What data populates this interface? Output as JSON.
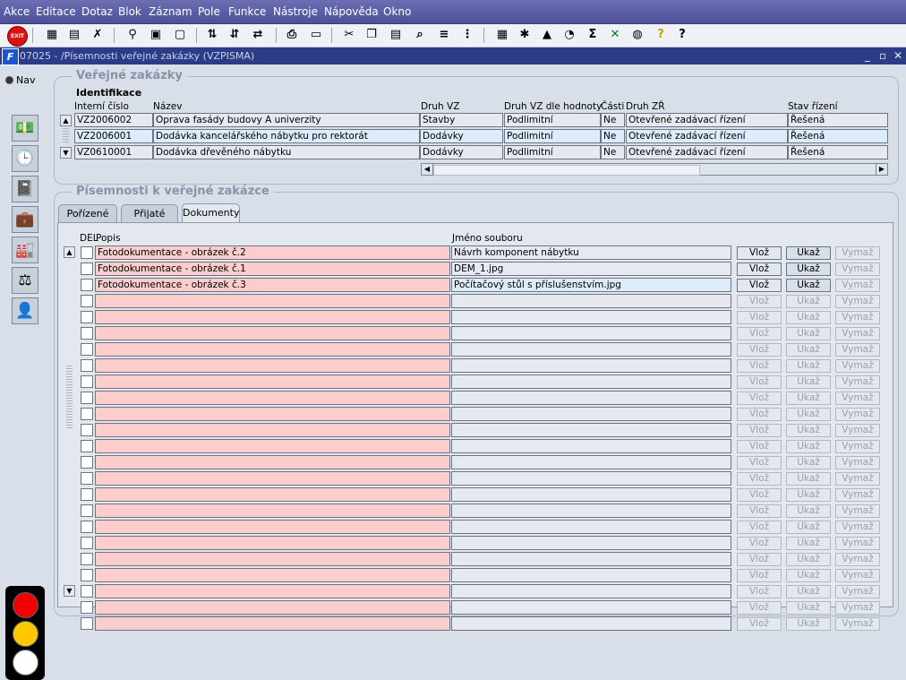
{
  "menu": [
    "Akce",
    "Editace",
    "Dotaz",
    "Blok",
    "Záznam",
    "Pole",
    "Funkce",
    "Nástroje",
    "Nápověda",
    "Okno"
  ],
  "toolbar_icons": [
    "exit-icon",
    "new-record-icon",
    "insert-record-icon",
    "delete-record-icon",
    "find-icon",
    "enter-query-icon",
    "cancel-query-icon",
    "sort-asc-icon",
    "sort-desc-icon",
    "sort-multi-icon",
    "print-icon",
    "print-preview-icon",
    "cut-icon",
    "copy-icon",
    "paste-icon",
    "search-replace-icon",
    "indent-icon",
    "columns-icon",
    "calculator-icon",
    "tools-icon",
    "warning-icon",
    "chart-icon",
    "sum-icon",
    "excel-icon",
    "globe-icon",
    "help-query-icon",
    "help-icon"
  ],
  "exit_label": "EXIT",
  "window": {
    "title": "07025 - /Písemnosti veřejné zakázky (VZPISMA)"
  },
  "nav_label": "Nav",
  "section1": {
    "title": "Veřejné zakázky",
    "subtitle": "Identifikace",
    "headers": {
      "interni": "Interní číslo",
      "nazev": "Název",
      "druh": "Druh VZ",
      "druh_hodnoty": "Druh VZ dle hodnoty",
      "casti": "Části",
      "druh_zr": "Druh ZŘ",
      "stav": "Stav řízení"
    },
    "rows": [
      {
        "interni": "VZ2006002",
        "nazev": "Oprava fasády budovy A univerzity",
        "druh": "Stavby",
        "druh_hodnoty": "Podlimitní",
        "casti": "Ne",
        "druh_zr": "Otevřené zadávací řízení",
        "stav": "Řešená",
        "selected": false
      },
      {
        "interni": "VZ2006001",
        "nazev": "Dodávka kancelářského nábytku pro rektorát",
        "druh": "Dodávky",
        "druh_hodnoty": "Podlimitní",
        "casti": "Ne",
        "druh_zr": "Otevřené zadávací řízení",
        "stav": "Řešená",
        "selected": true
      },
      {
        "interni": "VZ0610001",
        "nazev": "Dodávka dřevěného nábytku",
        "druh": "Dodávky",
        "druh_hodnoty": "Podlimitní",
        "casti": "Ne",
        "druh_zr": "Otevřené zadávací řízení",
        "stav": "Řešená",
        "selected": false
      }
    ]
  },
  "section2": {
    "title": "Písemnosti k veřejné zakázce",
    "tabs": [
      "Pořízené",
      "Přijaté",
      "Dokumenty"
    ],
    "active_tab": 2,
    "headers": {
      "del": "DEL",
      "popis": "Popis",
      "jmeno": "Jméno souboru"
    },
    "buttons": {
      "vloz": "Vlož",
      "ukaz": "Ukaž",
      "vymaz": "Vymaž"
    },
    "rows": [
      {
        "popis": "Fotodokumentace - obrázek č.2",
        "jmeno": "Návrh komponent nábytku",
        "selected": false,
        "vloz": true,
        "ukaz": true,
        "vymaz": false
      },
      {
        "popis": "Fotodokumentace - obrázek č.1",
        "jmeno": "DEM_1.jpg",
        "selected": false,
        "vloz": true,
        "ukaz": true,
        "vymaz": false
      },
      {
        "popis": "Fotodokumentace - obrázek č.3",
        "jmeno": "Počítačový stůl s příslušenstvím.jpg",
        "selected": true,
        "vloz": true,
        "ukaz": true,
        "vymaz": false
      },
      {
        "popis": "",
        "jmeno": "",
        "selected": false,
        "vloz": false,
        "ukaz": false,
        "vymaz": false
      },
      {
        "popis": "",
        "jmeno": "",
        "selected": false,
        "vloz": false,
        "ukaz": false,
        "vymaz": false
      },
      {
        "popis": "",
        "jmeno": "",
        "selected": false,
        "vloz": false,
        "ukaz": false,
        "vymaz": false
      },
      {
        "popis": "",
        "jmeno": "",
        "selected": false,
        "vloz": false,
        "ukaz": false,
        "vymaz": false
      },
      {
        "popis": "",
        "jmeno": "",
        "selected": false,
        "vloz": false,
        "ukaz": false,
        "vymaz": false
      },
      {
        "popis": "",
        "jmeno": "",
        "selected": false,
        "vloz": false,
        "ukaz": false,
        "vymaz": false
      },
      {
        "popis": "",
        "jmeno": "",
        "selected": false,
        "vloz": false,
        "ukaz": false,
        "vymaz": false
      },
      {
        "popis": "",
        "jmeno": "",
        "selected": false,
        "vloz": false,
        "ukaz": false,
        "vymaz": false
      },
      {
        "popis": "",
        "jmeno": "",
        "selected": false,
        "vloz": false,
        "ukaz": false,
        "vymaz": false
      },
      {
        "popis": "",
        "jmeno": "",
        "selected": false,
        "vloz": false,
        "ukaz": false,
        "vymaz": false
      },
      {
        "popis": "",
        "jmeno": "",
        "selected": false,
        "vloz": false,
        "ukaz": false,
        "vymaz": false
      },
      {
        "popis": "",
        "jmeno": "",
        "selected": false,
        "vloz": false,
        "ukaz": false,
        "vymaz": false
      },
      {
        "popis": "",
        "jmeno": "",
        "selected": false,
        "vloz": false,
        "ukaz": false,
        "vymaz": false
      },
      {
        "popis": "",
        "jmeno": "",
        "selected": false,
        "vloz": false,
        "ukaz": false,
        "vymaz": false
      },
      {
        "popis": "",
        "jmeno": "",
        "selected": false,
        "vloz": false,
        "ukaz": false,
        "vymaz": false
      },
      {
        "popis": "",
        "jmeno": "",
        "selected": false,
        "vloz": false,
        "ukaz": false,
        "vymaz": false
      },
      {
        "popis": "",
        "jmeno": "",
        "selected": false,
        "vloz": false,
        "ukaz": false,
        "vymaz": false
      },
      {
        "popis": "",
        "jmeno": "",
        "selected": false,
        "vloz": false,
        "ukaz": false,
        "vymaz": false
      },
      {
        "popis": "",
        "jmeno": "",
        "selected": false,
        "vloz": false,
        "ukaz": false,
        "vymaz": false
      },
      {
        "popis": "",
        "jmeno": "",
        "selected": false,
        "vloz": false,
        "ukaz": false,
        "vymaz": false
      },
      {
        "popis": "",
        "jmeno": "",
        "selected": false,
        "vloz": false,
        "ukaz": false,
        "vymaz": false
      }
    ]
  },
  "side_icons": [
    "money-icon",
    "clock-icon",
    "notebook-icon",
    "briefcase-icon",
    "factory-icon",
    "scales-icon",
    "person-icon"
  ],
  "traffic_colors": {
    "red": "#f00000",
    "yellow": "#ffc800",
    "white": "#ffffff"
  }
}
